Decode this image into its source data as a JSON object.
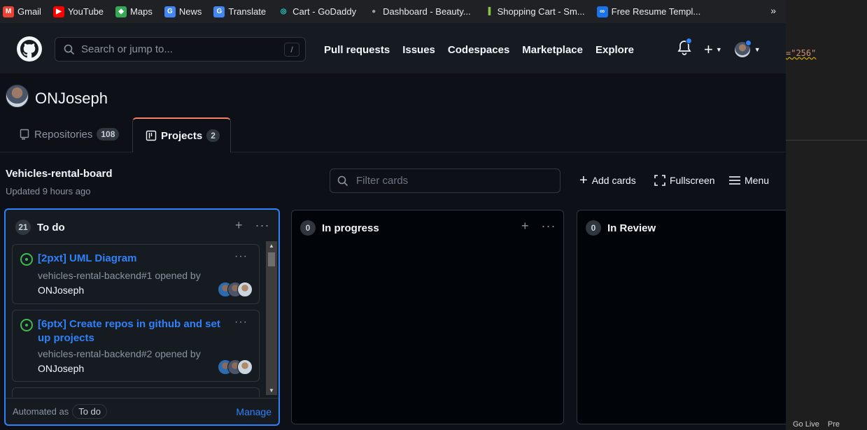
{
  "bookmarks": [
    {
      "label": "Gmail",
      "icon": "gmail-icon",
      "color": "#ea4335"
    },
    {
      "label": "YouTube",
      "icon": "youtube-icon",
      "color": "#ff0000"
    },
    {
      "label": "Maps",
      "icon": "maps-icon",
      "color": "#34a853"
    },
    {
      "label": "News",
      "icon": "news-icon",
      "color": "#4285f4"
    },
    {
      "label": "Translate",
      "icon": "translate-icon",
      "color": "#4285f4"
    },
    {
      "label": "Cart - GoDaddy",
      "icon": "godaddy-icon",
      "color": "#1bdbdb"
    },
    {
      "label": "Dashboard - Beauty...",
      "icon": "globe-icon",
      "color": "#9aa0a6"
    },
    {
      "label": "Shopping Cart - Sm...",
      "icon": "shop-icon",
      "color": "#8bc34a"
    },
    {
      "label": "Free Resume Templ...",
      "icon": "link-icon",
      "color": "#1a73e8"
    }
  ],
  "bookmarks_more": "»",
  "editor": {
    "code": "=\"256\"",
    "status_left": "Go Live",
    "status_right": "Pre"
  },
  "header": {
    "search_placeholder": "Search or jump to...",
    "search_shortcut": "/",
    "nav": [
      "Pull requests",
      "Issues",
      "Codespaces",
      "Marketplace",
      "Explore"
    ]
  },
  "profile": {
    "username": "ONJoseph",
    "tabs": [
      {
        "label": "Repositories",
        "count": "108"
      },
      {
        "label": "Projects",
        "count": "2"
      }
    ]
  },
  "project": {
    "title": "Vehicles-rental-board",
    "updated": "Updated 9 hours ago",
    "filter_placeholder": "Filter cards",
    "actions": {
      "add": "Add cards",
      "fullscreen": "Fullscreen",
      "menu": "Menu"
    }
  },
  "columns": [
    {
      "name": "To do",
      "count": "21",
      "footer_label": "Automated as",
      "footer_tag": "To do",
      "footer_link": "Manage",
      "cards": [
        {
          "title": "[2pxt] UML Diagram",
          "meta": "vehicles-rental-backend#1 opened by",
          "author": "ONJoseph"
        },
        {
          "title": "[6ptx] Create repos in github and set up projects",
          "meta": "vehicles-rental-backend#2 opened by",
          "author": "ONJoseph"
        }
      ]
    },
    {
      "name": "In progress",
      "count": "0"
    },
    {
      "name": "In Review",
      "count": "0"
    }
  ]
}
